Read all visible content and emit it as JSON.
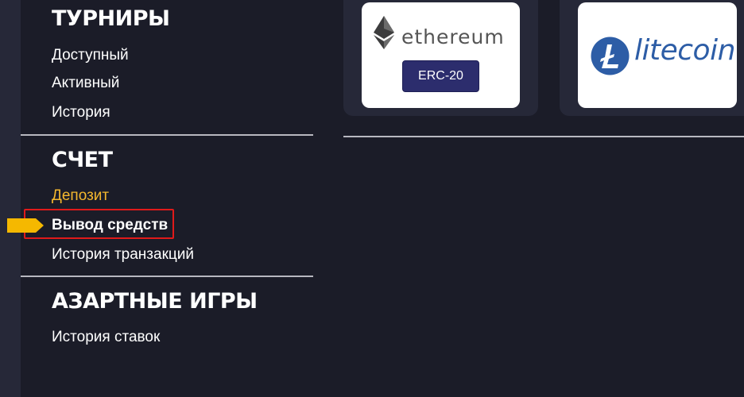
{
  "sidebar": {
    "tournaments": {
      "title": "ТУРНИРЫ",
      "items": [
        "Доступный",
        "Активный",
        "История"
      ]
    },
    "account": {
      "title": "СЧЕТ",
      "items": [
        "Депозит",
        "Вывод средств",
        "История транзакций"
      ],
      "active_item": "Депозит",
      "highlighted_item": "Вывод средств"
    },
    "gambling": {
      "title": "АЗАРТНЫЕ ИГРЫ",
      "items": [
        "История ставок"
      ]
    }
  },
  "cards": {
    "ethereum": {
      "name": "ethereum",
      "badge": "ERC-20"
    },
    "litecoin": {
      "name": "litecoin"
    }
  },
  "colors": {
    "background": "#1b1c28",
    "card": "#262838",
    "active_link": "#f5b82e",
    "highlight_border": "#e01a1a",
    "arrow": "#f5b800",
    "erc_badge": "#2c2d6d",
    "litecoin_blue": "#2d5da6"
  },
  "icons": {
    "ethereum": "ethereum-diamond-icon",
    "litecoin": "litecoin-coin-icon",
    "pointer": "pointer-arrow-icon"
  }
}
